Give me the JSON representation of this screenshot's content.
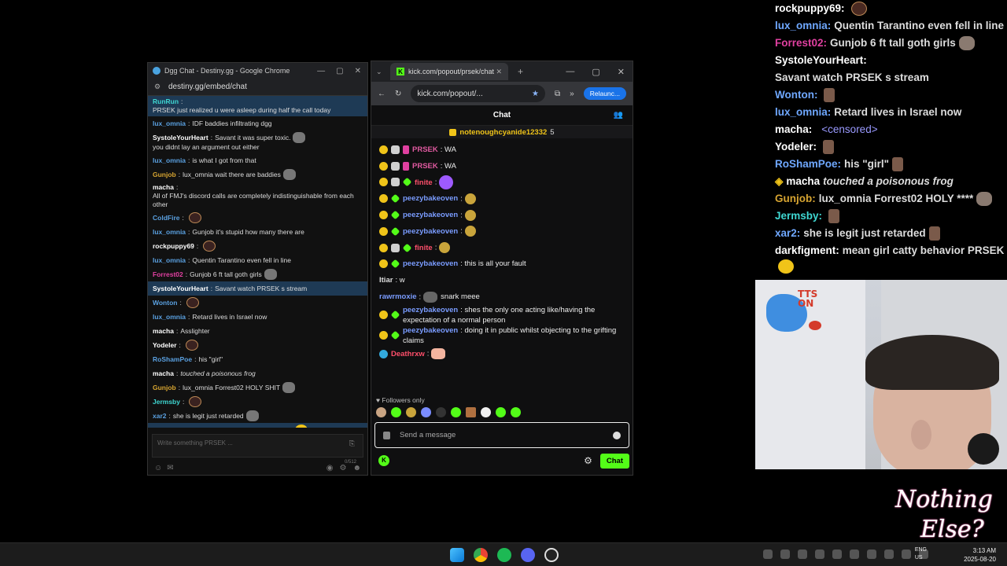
{
  "dgg_window": {
    "title": "Dgg Chat - Destiny.gg - Google Chrome",
    "url": "destiny.gg/embed/chat",
    "messages": [
      {
        "user": "RunRun",
        "color": "cyan",
        "text": "PRSEK just realized u were asleep during half the call today",
        "highlight": true
      },
      {
        "user": "lux_omnia",
        "color": "blue",
        "text": "IDF baddies infiltrating dgg"
      },
      {
        "user": "SystoleYourHeart",
        "color": "white",
        "text": "Savant it was super toxic.",
        "text2": "you didnt lay an argument out either"
      },
      {
        "user": "lux_omnia",
        "color": "blue",
        "text": "is what I got from that"
      },
      {
        "user": "Gunjob",
        "color": "gold",
        "text": "lux_omnia wait there are baddies"
      },
      {
        "user": "macha",
        "color": "white",
        "text": "All of FMJ's discord calls are completely indistinguishable from each other"
      },
      {
        "user": "ColdFire",
        "color": "blue",
        "text": ""
      },
      {
        "user": "lux_omnia",
        "color": "blue",
        "text": "Gunjob it's stupid how many there are"
      },
      {
        "user": "rockpuppy69",
        "color": "white",
        "text": ""
      },
      {
        "user": "lux_omnia",
        "color": "blue",
        "text": "Quentin Tarantino even fell in line"
      },
      {
        "user": "Forrest02",
        "color": "pink",
        "text": "Gunjob 6 ft tall goth girls"
      },
      {
        "user": "SystoleYourHeart",
        "color": "white",
        "text": "Savant watch PRSEK s stream",
        "highlight": true
      },
      {
        "user": "Wonton",
        "color": "blue",
        "text": ""
      },
      {
        "user": "lux_omnia",
        "color": "blue",
        "text": "Retard lives in Israel now"
      },
      {
        "user": "macha",
        "color": "white",
        "text": "Asslighter"
      },
      {
        "user": "Yodeler",
        "color": "white",
        "text": ""
      },
      {
        "user": "RoShamPoe",
        "color": "blue",
        "text": "his \"girl\""
      },
      {
        "user": "macha",
        "color": "white",
        "text": "touched a poisonous frog",
        "italic": true
      },
      {
        "user": "Gunjob",
        "color": "gold",
        "text": "lux_omnia Forrest02 HOLY SHIT"
      },
      {
        "user": "Jermsby",
        "color": "cyan",
        "text": ""
      },
      {
        "user": "xar2",
        "color": "blue",
        "text": "she is legit just retarded"
      },
      {
        "user": "darkfigment",
        "color": "white",
        "text": "mean girl catty behavior PRSEK",
        "highlight": true
      }
    ],
    "composer_placeholder": "Write something PRSEK ...",
    "char_count": "0/512"
  },
  "kick_window": {
    "tab_title": "kick.com/popout/prsek/chat",
    "url": "kick.com/popout/...",
    "relaunch_label": "Relaunc...",
    "header": "Chat",
    "pinned_user": "notenoughcyanide12332",
    "pinned_count": "5",
    "messages": [
      {
        "badges": [
          "sub",
          "gray",
          "mic"
        ],
        "user": "PRSEK",
        "ucolor": "mag",
        "text": ": WA"
      },
      {
        "badges": [
          "sub",
          "gray",
          "mic"
        ],
        "user": "PRSEK",
        "ucolor": "mag",
        "text": ": WA"
      },
      {
        "badges": [
          "sub",
          "gray",
          "vip"
        ],
        "user": "finite",
        "ucolor": "pink",
        "text": ":",
        "emote": "big"
      },
      {
        "badges": [
          "sub",
          "vip"
        ],
        "user": "peezybakeoven",
        "ucolor": "blue",
        "text": ":",
        "emote": "small"
      },
      {
        "badges": [
          "sub",
          "vip"
        ],
        "user": "peezybakeoven",
        "ucolor": "blue",
        "text": ":",
        "emote": "small"
      },
      {
        "badges": [
          "sub",
          "vip"
        ],
        "user": "peezybakeoven",
        "ucolor": "blue",
        "text": ":",
        "emote": "small"
      },
      {
        "badges": [
          "sub",
          "gray",
          "vip"
        ],
        "user": "finite",
        "ucolor": "pink",
        "text": ":",
        "emote": "small"
      },
      {
        "badges": [
          "sub",
          "vip"
        ],
        "user": "peezybakeoven",
        "ucolor": "blue",
        "text": ": this is all your fault"
      },
      {
        "badges": [],
        "user": "Itiar",
        "ucolor": "white",
        "text": ": w"
      },
      {
        "badges": [],
        "user": "rawrmoxie",
        "ucolor": "blue",
        "text": ":",
        "emote": "rock",
        "text2": "snark meee"
      },
      {
        "badges": [
          "sub",
          "vip"
        ],
        "user": "peezybakeoven",
        "ucolor": "blue",
        "text": ": shes the only one acting like/having the expectation of a normal person"
      },
      {
        "badges": [
          "sub",
          "vip"
        ],
        "user": "peezybakeoven",
        "ucolor": "blue",
        "text": ": doing it in public whilst objecting to the grifting claims"
      },
      {
        "badges": [
          "tiny"
        ],
        "user": "Deathrxw",
        "ucolor": "pink",
        "text": ":",
        "emote": "hand"
      }
    ],
    "followers_only": "Followers only",
    "input_placeholder": "Send a message",
    "chat_button": "Chat"
  },
  "overlay_chat": [
    {
      "user": "rockpuppy69:",
      "color": "white",
      "text": "",
      "emote": "dark"
    },
    {
      "user": "lux_omnia:",
      "color": "blue",
      "text": "Quentin Tarantino even fell in line"
    },
    {
      "user": "Forrest02:",
      "color": "pink",
      "text": "Gunjob 6 ft tall goth girls",
      "emote": "gray"
    },
    {
      "user": "SystoleYourHeart:",
      "color": "white",
      "text": "Savant watch PRSEK s stream"
    },
    {
      "user": "Wonton:",
      "color": "blue",
      "text": "",
      "emote": "pic"
    },
    {
      "user": "lux_omnia:",
      "color": "blue",
      "text": "Retard lives in Israel now"
    },
    {
      "user": "macha:",
      "color": "white",
      "text": "",
      "censored": "<censored>"
    },
    {
      "user": "Yodeler:",
      "color": "white",
      "text": "",
      "emote": "pic"
    },
    {
      "user": "RoShamPoe:",
      "color": "blue",
      "text": "his \"girl\"",
      "emote": "pic"
    },
    {
      "user": "macha",
      "color": "white",
      "text": "touched a poisonous frog",
      "italic": true,
      "prefix": "◈"
    },
    {
      "user": "Gunjob:",
      "color": "gold",
      "text": "lux_omnia Forrest02 HOLY ****",
      "emote": "gray"
    },
    {
      "user": "Jermsby:",
      "color": "cyan",
      "text": "",
      "emote": "pic"
    },
    {
      "user": "xar2:",
      "color": "blue",
      "text": "she is legit just retarded",
      "emote": "pic"
    },
    {
      "user": "darkfigment:",
      "color": "white",
      "text": "mean girl catty behavior PRSEK",
      "emote": "yellow"
    }
  ],
  "webcam": {
    "tts_label": "TTS ON"
  },
  "branding": {
    "line1": "Nothing",
    "line2": "Else?"
  },
  "taskbar": {
    "lang1": "ENG",
    "lang2": "US",
    "time": "3:13 AM",
    "date": "2025-08-20"
  }
}
